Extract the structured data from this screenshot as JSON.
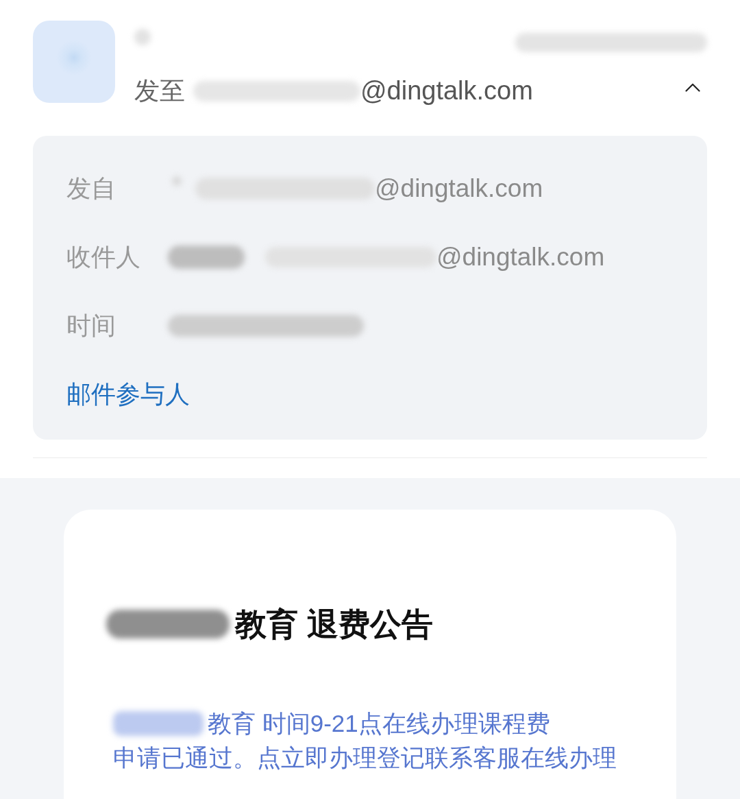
{
  "header": {
    "recipient_label": "发至",
    "recipient_address": "@dingtalk.com",
    "expanded": true
  },
  "details": {
    "rows": [
      {
        "kind": "sender",
        "label": "发自",
        "address": "@dingtalk.com"
      },
      {
        "kind": "recipient",
        "label": "收件人",
        "address": "@dingtalk.com"
      },
      {
        "kind": "time",
        "label": "时间"
      }
    ],
    "link": "邮件参与人"
  },
  "message": {
    "title": {
      "text": "教育 退费公告",
      "redacted_prefix": true
    },
    "lines": [
      {
        "text": "教育 时间9-21点在线办理课程费",
        "redacted_prefix": true
      },
      {
        "text": "申请已通过。点立即办理登记联系客服在线办理",
        "redacted_prefix": false
      }
    ]
  }
}
